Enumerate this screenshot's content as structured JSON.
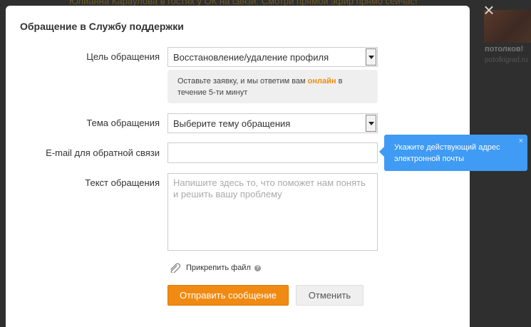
{
  "background": {
    "banner_text": "Юлианна Караулова в гостях у ОК на связи: Смотри прямой эфир прямо сейчас!",
    "thumb_title": "потолков!",
    "thumb_url": "potolkigrad.ru"
  },
  "modal": {
    "title": "Обращение в Службу поддержки",
    "close_symbol": "×",
    "purpose": {
      "label": "Цель обращения",
      "value": "Восстановление/удаление профиля"
    },
    "hint": {
      "text_before": "Оставьте заявку, и мы ответим вам ",
      "highlight": "онлайн",
      "text_after": " в течение 5-ти минут"
    },
    "topic": {
      "label": "Тема обращения",
      "value": "Выберите тему обращения"
    },
    "email": {
      "label": "E-mail для обратной связи",
      "value": ""
    },
    "message": {
      "label": "Текст обращения",
      "placeholder": "Напишите здесь то, что поможет нам понять и решить вашу проблему"
    },
    "attach_label": "Прикрепить файл",
    "help_symbol": "?",
    "send_button": "Отправить сообщение",
    "cancel_button": "Отменить"
  },
  "tooltip": {
    "text": "Укажите действующий адрес электронной почты",
    "close_symbol": "×"
  },
  "colors": {
    "accent_orange": "#f08a12",
    "tooltip_blue": "#3f9bf4",
    "overlay": "#2f2f2f"
  }
}
